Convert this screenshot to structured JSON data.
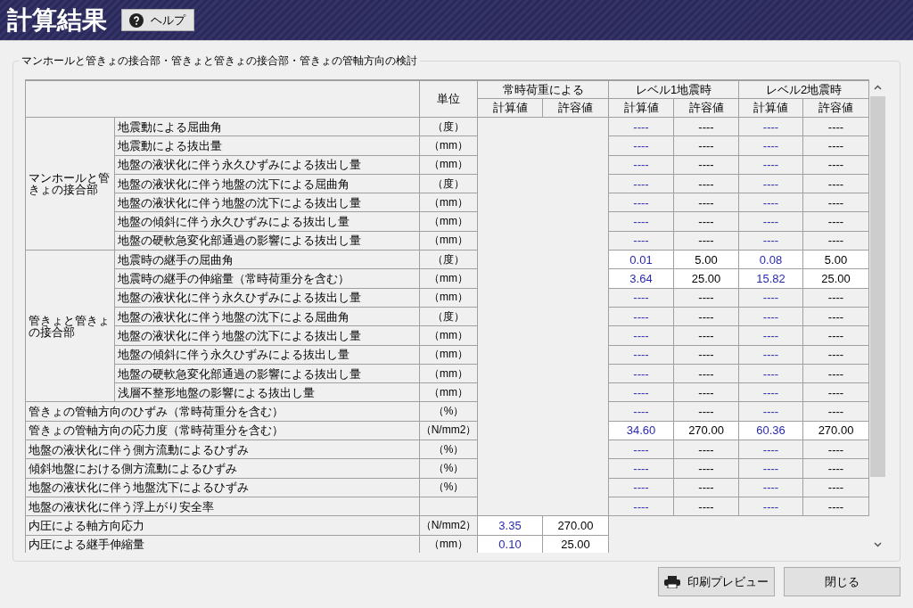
{
  "header": {
    "title": "計算結果",
    "help_button": "ヘルプ"
  },
  "panel": {
    "caption": "マンホールと管きょの接合部・管きょと管きょの接合部・管きょの管軸方向の検討"
  },
  "table": {
    "unit_heading": "単位",
    "groups": [
      {
        "label": "常時荷重による",
        "columns": [
          "計算値",
          "許容値"
        ]
      },
      {
        "label": "レベル1地震時",
        "columns": [
          "計算値",
          "許容値"
        ]
      },
      {
        "label": "レベル2地震時",
        "columns": [
          "計算値",
          "許容値"
        ]
      }
    ],
    "sections": [
      {
        "label": "マンホールと管きょの接合部",
        "rows": [
          {
            "item": "地震動による屈曲角",
            "unit": "（度）",
            "computed": false,
            "level1": [
              "----",
              "----"
            ],
            "level2": [
              "----",
              "----"
            ]
          },
          {
            "item": "地震動による抜出量",
            "unit": "（mm）",
            "computed": false,
            "level1": [
              "----",
              "----"
            ],
            "level2": [
              "----",
              "----"
            ]
          },
          {
            "item": "地盤の液状化に伴う永久ひずみによる抜出し量",
            "unit": "（mm）",
            "computed": false,
            "level1": [
              "----",
              "----"
            ],
            "level2": [
              "----",
              "----"
            ]
          },
          {
            "item": "地盤の液状化に伴う地盤の沈下による屈曲角",
            "unit": "（度）",
            "computed": false,
            "level1": [
              "----",
              "----"
            ],
            "level2": [
              "----",
              "----"
            ]
          },
          {
            "item": "地盤の液状化に伴う地盤の沈下による抜出し量",
            "unit": "（mm）",
            "computed": false,
            "level1": [
              "----",
              "----"
            ],
            "level2": [
              "----",
              "----"
            ]
          },
          {
            "item": "地盤の傾斜に伴う永久ひずみによる抜出し量",
            "unit": "（mm）",
            "computed": false,
            "level1": [
              "----",
              "----"
            ],
            "level2": [
              "----",
              "----"
            ]
          },
          {
            "item": "地盤の硬軟急変化部通過の影響による抜出し量",
            "unit": "（mm）",
            "computed": false,
            "level1": [
              "----",
              "----"
            ],
            "level2": [
              "----",
              "----"
            ]
          }
        ]
      },
      {
        "label": "管きょと管きょの接合部",
        "rows": [
          {
            "item": "地震時の継手の屈曲角",
            "unit": "（度）",
            "computed": true,
            "level1": [
              "0.01",
              "5.00"
            ],
            "level2": [
              "0.08",
              "5.00"
            ]
          },
          {
            "item": "地震時の継手の伸縮量（常時荷重分を含む）",
            "unit": "（mm）",
            "computed": true,
            "level1": [
              "3.64",
              "25.00"
            ],
            "level2": [
              "15.82",
              "25.00"
            ]
          },
          {
            "item": "地盤の液状化に伴う永久ひずみによる抜出し量",
            "unit": "（mm）",
            "computed": false,
            "level1": [
              "----",
              "----"
            ],
            "level2": [
              "----",
              "----"
            ]
          },
          {
            "item": "地盤の液状化に伴う地盤の沈下による屈曲角",
            "unit": "（度）",
            "computed": false,
            "level1": [
              "----",
              "----"
            ],
            "level2": [
              "----",
              "----"
            ]
          },
          {
            "item": "地盤の液状化に伴う地盤の沈下による抜出し量",
            "unit": "（mm）",
            "computed": false,
            "level1": [
              "----",
              "----"
            ],
            "level2": [
              "----",
              "----"
            ]
          },
          {
            "item": "地盤の傾斜に伴う永久ひずみによる抜出し量",
            "unit": "（mm）",
            "computed": false,
            "level1": [
              "----",
              "----"
            ],
            "level2": [
              "----",
              "----"
            ]
          },
          {
            "item": "地盤の硬軟急変化部通過の影響による抜出し量",
            "unit": "（mm）",
            "computed": false,
            "level1": [
              "----",
              "----"
            ],
            "level2": [
              "----",
              "----"
            ]
          },
          {
            "item": "浅層不整形地盤の影響による抜出し量",
            "unit": "（mm）",
            "computed": false,
            "level1": [
              "----",
              "----"
            ],
            "level2": [
              "----",
              "----"
            ]
          }
        ]
      },
      {
        "rows": [
          {
            "item": "管きょの管軸方向のひずみ（常時荷重分を含む）",
            "unit": "（%）",
            "computed": false,
            "level1": [
              "----",
              "----"
            ],
            "level2": [
              "----",
              "----"
            ]
          },
          {
            "item": "管きょの管軸方向の応力度（常時荷重分を含む）",
            "unit": "（N/mm2）",
            "computed": true,
            "level1": [
              "34.60",
              "270.00"
            ],
            "level2": [
              "60.36",
              "270.00"
            ]
          },
          {
            "item": "地盤の液状化に伴う側方流動によるひずみ",
            "unit": "（%）",
            "computed": false,
            "level1": [
              "----",
              "----"
            ],
            "level2": [
              "----",
              "----"
            ]
          },
          {
            "item": "傾斜地盤における側方流動によるひずみ",
            "unit": "（%）",
            "computed": false,
            "level1": [
              "----",
              "----"
            ],
            "level2": [
              "----",
              "----"
            ]
          },
          {
            "item": "地盤の液状化に伴う地盤沈下によるひずみ",
            "unit": "（%）",
            "computed": false,
            "level1": [
              "----",
              "----"
            ],
            "level2": [
              "----",
              "----"
            ]
          },
          {
            "item": "地盤の液状化に伴う浮上がり安全率",
            "computed": false,
            "level1": [
              "----",
              "----"
            ],
            "level2": [
              "----",
              "----"
            ]
          },
          {
            "item": "内圧による軸方向応力",
            "unit": "（N/mm2）",
            "computed": true,
            "normal": [
              "3.35",
              "270.00"
            ]
          },
          {
            "item": "内圧による継手伸縮量",
            "unit": "（mm）",
            "computed": true,
            "normal": [
              "0.10",
              "25.00"
            ]
          }
        ]
      }
    ]
  },
  "buttons": {
    "print_preview": "印刷プレビュー",
    "close": "閉じる"
  }
}
